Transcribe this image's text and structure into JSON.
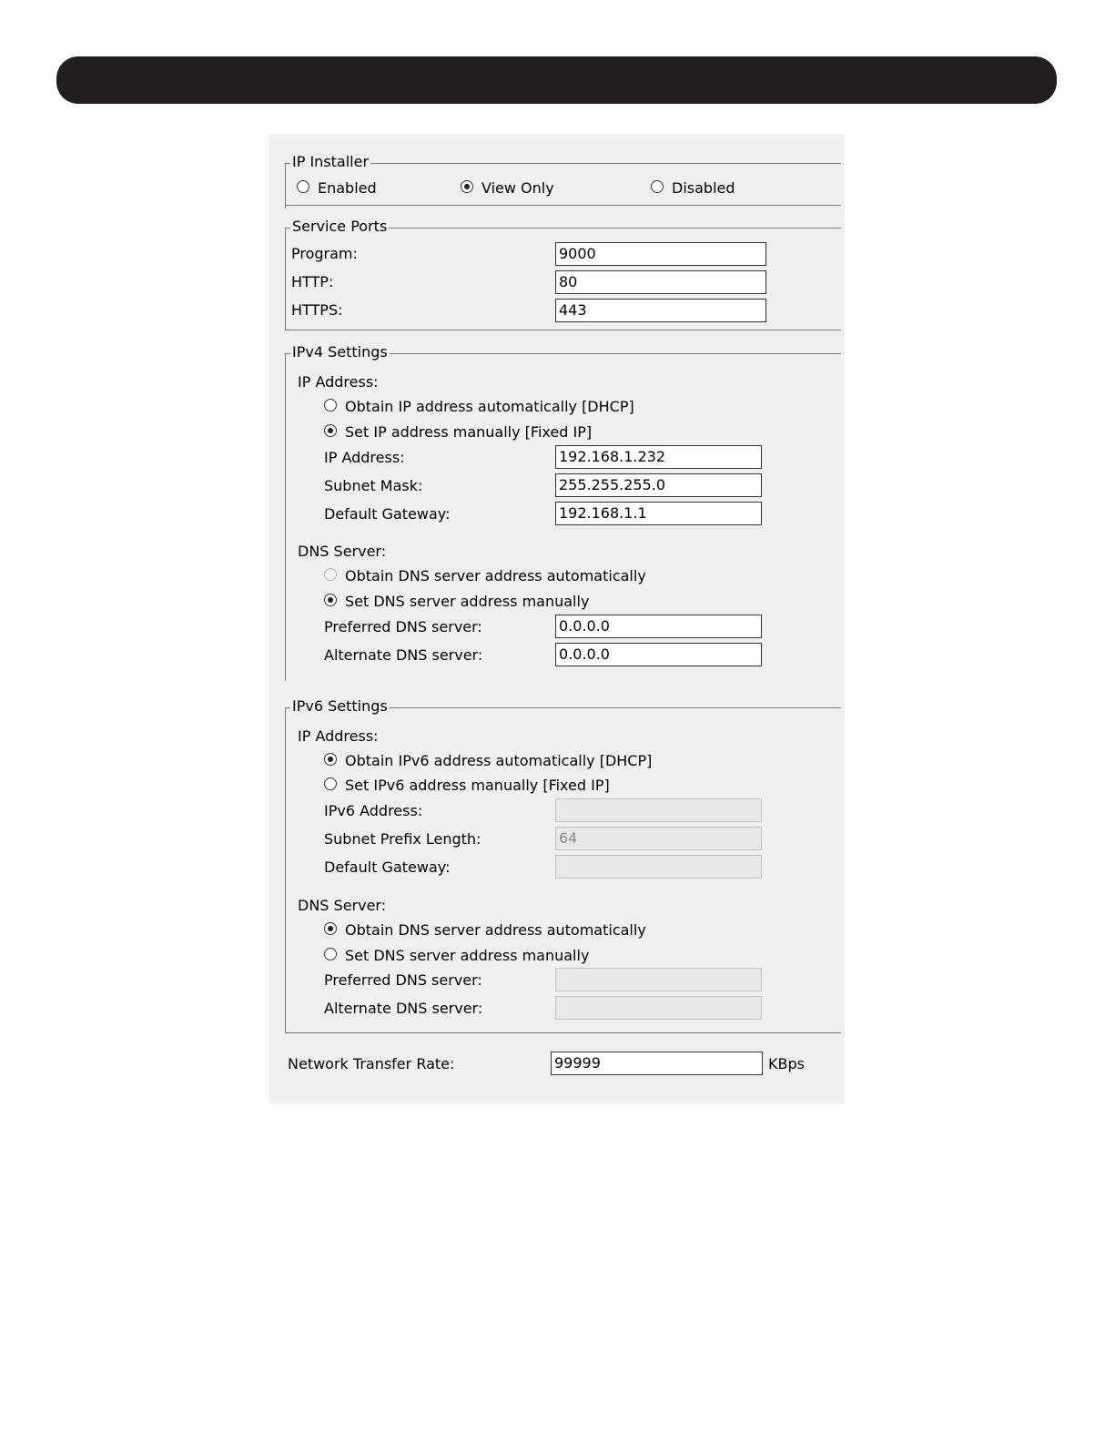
{
  "ip_installer": {
    "legend": "IP Installer",
    "options": [
      {
        "label": "Enabled",
        "checked": false
      },
      {
        "label": "View Only",
        "checked": true
      },
      {
        "label": "Disabled",
        "checked": false
      }
    ]
  },
  "service_ports": {
    "legend": "Service Ports",
    "program_label": "Program:",
    "program_value": "9000",
    "http_label": "HTTP:",
    "http_value": "80",
    "https_label": "HTTPS:",
    "https_value": "443"
  },
  "ipv4": {
    "legend": "IPv4 Settings",
    "ip_heading": "IP Address:",
    "auto_label": "Obtain IP address automatically [DHCP]",
    "manual_label": "Set IP address manually [Fixed IP]",
    "auto_checked": false,
    "manual_checked": true,
    "ip_label": "IP Address:",
    "ip_value": "192.168.1.232",
    "subnet_label": "Subnet Mask:",
    "subnet_value": "255.255.255.0",
    "gateway_label": "Default Gateway:",
    "gateway_value": "192.168.1.1",
    "dns_heading": "DNS Server:",
    "dns_auto_label": "Obtain DNS server address automatically",
    "dns_manual_label": "Set DNS server address manually",
    "dns_auto_checked": false,
    "dns_manual_checked": true,
    "preferred_label": "Preferred DNS server:",
    "preferred_value": "0.0.0.0",
    "alternate_label": "Alternate DNS server:",
    "alternate_value": "0.0.0.0"
  },
  "ipv6": {
    "legend": "IPv6 Settings",
    "ip_heading": "IP Address:",
    "auto_label": "Obtain IPv6 address automatically [DHCP]",
    "manual_label": "Set IPv6 address manually [Fixed IP]",
    "auto_checked": true,
    "manual_checked": false,
    "ip_label": "IPv6 Address:",
    "ip_value": "",
    "prefix_label": "Subnet Prefix Length:",
    "prefix_value": "64",
    "gateway_label": "Default Gateway:",
    "gateway_value": "",
    "dns_heading": "DNS Server:",
    "dns_auto_label": "Obtain DNS server address automatically",
    "dns_manual_label": "Set DNS server address manually",
    "dns_auto_checked": true,
    "dns_manual_checked": false,
    "preferred_label": "Preferred DNS server:",
    "preferred_value": "",
    "alternate_label": "Alternate DNS server:",
    "alternate_value": ""
  },
  "transfer_rate": {
    "label": "Network Transfer Rate:",
    "value": "99999",
    "unit": "KBps"
  }
}
